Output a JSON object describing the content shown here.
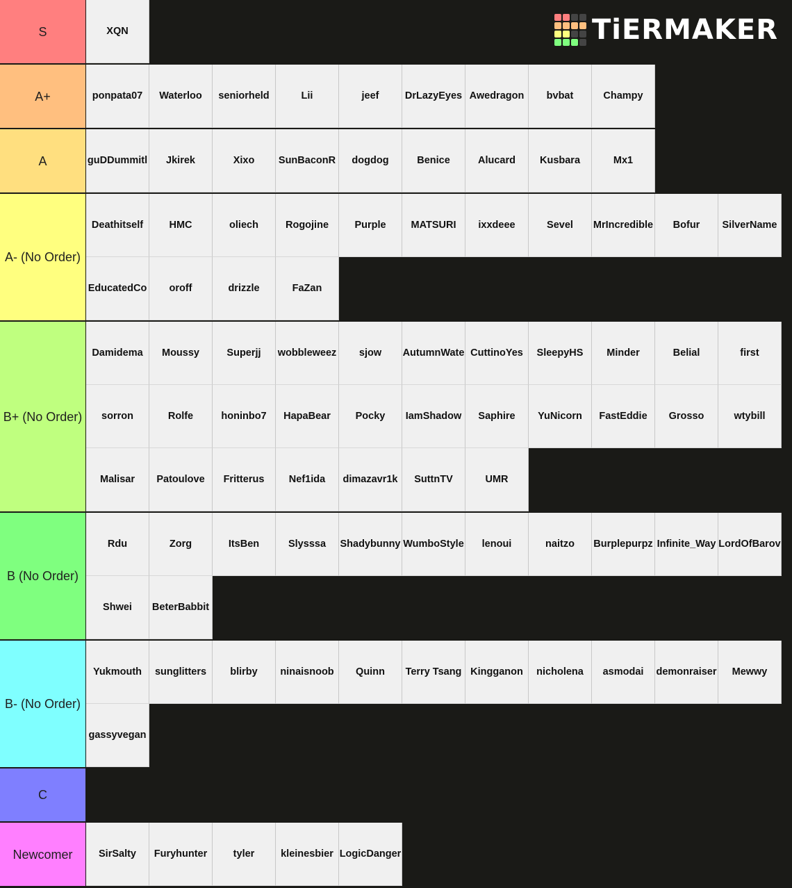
{
  "logo": {
    "text": "TiERMAKER",
    "grid_colors": [
      "#ff7f7f",
      "#ff7f7f",
      "#444444",
      "#444444",
      "#ffbf7f",
      "#ffbf7f",
      "#ffbf7f",
      "#ffbf7f",
      "#ffff7f",
      "#ffff7f",
      "#444444",
      "#444444",
      "#7fff7f",
      "#7fff7f",
      "#7fff7f",
      "#444444"
    ]
  },
  "tiers": [
    {
      "label": "S",
      "color": "#ff7f7f",
      "items": [
        "XQN"
      ]
    },
    {
      "label": "A+",
      "color": "#ffbf7f",
      "items": [
        "ponpata07",
        "Waterloo",
        "seniorheld",
        "Lii",
        "jeef",
        "DrLazyEyes",
        "Awedragon",
        "bvbat",
        "Champy"
      ]
    },
    {
      "label": "A",
      "color": "#ffdf7f",
      "items": [
        "guDDummitl",
        "Jkirek",
        "Xixo",
        "SunBaconR",
        "dogdog",
        "Benice",
        "Alucard",
        "Kusbara",
        "Mx1"
      ]
    },
    {
      "label": "A- (No Order)",
      "color": "#ffff7f",
      "items": [
        "Deathitself",
        "HMC",
        "oliech",
        "Rogojine",
        "Purple",
        "MATSURI",
        "ixxdeee",
        "Sevel",
        "MrIncredible",
        "Bofur",
        "SilverName",
        "EducatedCo",
        "oroff",
        "drizzle",
        "FaZan"
      ]
    },
    {
      "label": "B+ (No Order)",
      "color": "#bfff7f",
      "items": [
        "Damidema",
        "Moussy",
        "Superjj",
        "wobbleweez",
        "sjow",
        "AutumnWate",
        "CuttinoYes",
        "SleepyHS",
        "Minder",
        "Belial",
        "first",
        "sorron",
        "Rolfe",
        "honinbo7",
        "HapaBear",
        "Pocky",
        "IamShadow",
        "Saphire",
        "YuNicorn",
        "FastEddie",
        "Grosso",
        "wtybill",
        "Malisar",
        "Patoulove",
        "Fritterus",
        "Nef1ida",
        "dimazavr1k",
        "SuttnTV",
        "UMR"
      ]
    },
    {
      "label": "B (No Order)",
      "color": "#7fff7f",
      "items": [
        "Rdu",
        "Zorg",
        "ItsBen",
        "Slysssa",
        "Shadybunny",
        "WumboStyle",
        "lenoui",
        "naitzo",
        "Burplepurpz",
        "Infinite_Way",
        "LordOfBarov",
        "Shwei",
        "BeterBabbit"
      ]
    },
    {
      "label": "B- (No Order)",
      "color": "#7fffff",
      "items": [
        "Yukmouth",
        "sunglitters",
        "blirby",
        "ninaisnoob",
        "Quinn",
        "Terry Tsang",
        "Kingganon",
        "nicholena",
        "asmodai",
        "demonraiser",
        "Mewwy",
        "gassyvegan"
      ]
    },
    {
      "label": "C",
      "color": "#7f7fff",
      "items": []
    },
    {
      "label": "Newcomer",
      "color": "#ff7fff",
      "items": [
        "SirSalty",
        "Furyhunter",
        "tyler",
        "kleinesbier",
        "LogicDanger"
      ]
    }
  ]
}
